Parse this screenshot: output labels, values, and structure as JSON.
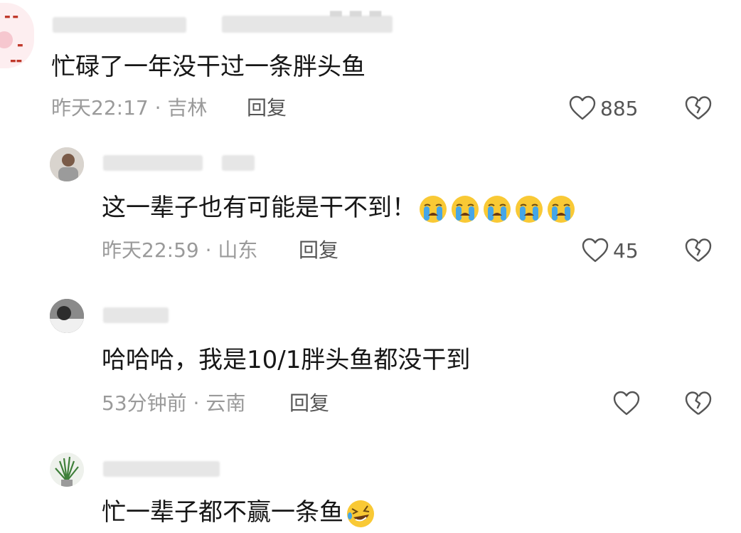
{
  "comments": [
    {
      "text": "忙碌了一年没干过一条胖头鱼",
      "time": "昨天22:17",
      "location": "吉林",
      "reply_label": "回复",
      "likes": "885"
    },
    {
      "text": "这一辈子也有可能是干不到！",
      "time": "昨天22:59",
      "location": "山东",
      "reply_label": "回复",
      "likes": "45",
      "emoji": [
        "loudly-crying-face-icon",
        "loudly-crying-face-icon",
        "loudly-crying-face-icon",
        "loudly-crying-face-icon",
        "loudly-crying-face-icon"
      ]
    },
    {
      "text": "哈哈哈，我是10/1胖头鱼都没干到",
      "time": "53分钟前",
      "location": "云南",
      "reply_label": "回复",
      "likes": ""
    },
    {
      "text": "忙一辈子都不赢一条鱼",
      "emoji": [
        "rolling-on-floor-laughing-icon"
      ]
    }
  ],
  "separator": "·",
  "colors": {
    "text": "#161616",
    "meta": "#9a9a9a",
    "icon": "#555555",
    "emoji_face": "#f9c935",
    "emoji_tears": "#45a6e8"
  }
}
